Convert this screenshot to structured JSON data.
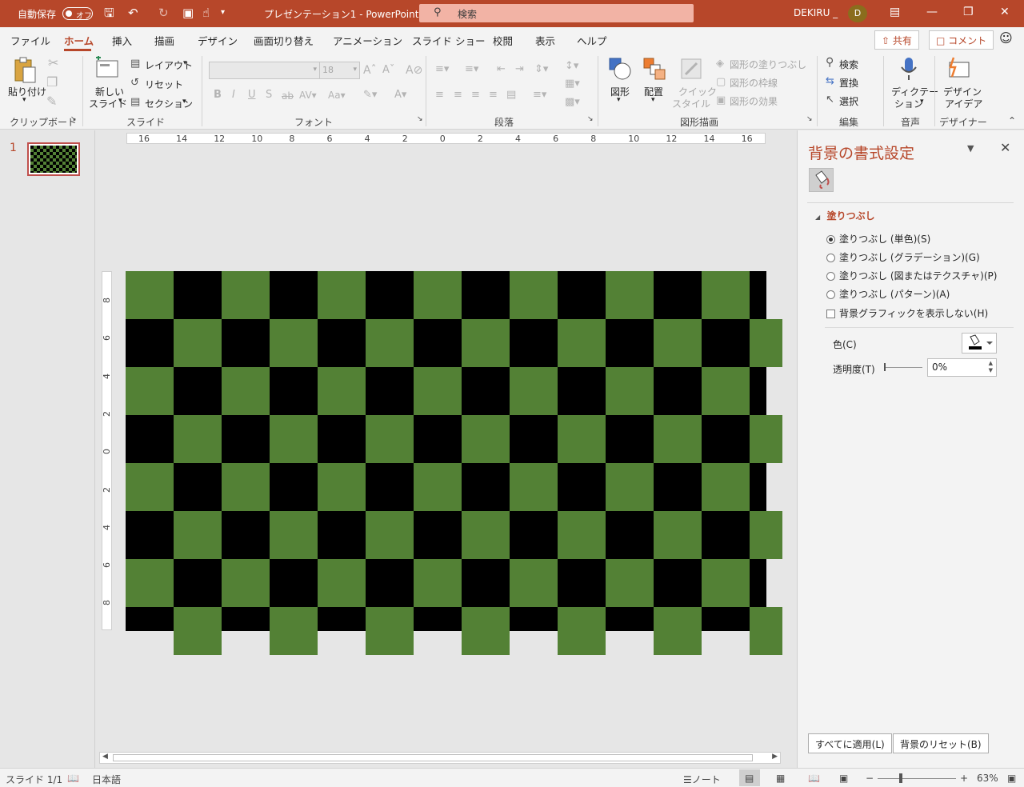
{
  "titlebar": {
    "autosave_label": "自動保存",
    "autosave_state": "オフ",
    "doc_title": "プレゼンテーション1  -  PowerPoint",
    "search_placeholder": "検索",
    "user_name": "DEKIRU _",
    "avatar_initial": "D"
  },
  "tabs": [
    "ファイル",
    "ホーム",
    "挿入",
    "描画",
    "デザイン",
    "画面切り替え",
    "アニメーション",
    "スライド ショー",
    "校閲",
    "表示",
    "ヘルプ"
  ],
  "share_label": "共有",
  "comment_label": "コメント",
  "ribbon": {
    "clipboard": {
      "paste": "貼り付け",
      "group": "クリップボード"
    },
    "slides": {
      "new_slide_1": "新しい",
      "new_slide_2": "スライド",
      "layout": "レイアウト",
      "reset": "リセット",
      "section": "セクション",
      "group": "スライド"
    },
    "font": {
      "font_size": "18",
      "group": "フォント"
    },
    "paragraph": {
      "group": "段落"
    },
    "drawing": {
      "shapes": "図形",
      "arrange": "配置",
      "quick_1": "クイック",
      "quick_2": "スタイル",
      "shape_fill": "図形の塗りつぶし",
      "shape_outline": "図形の枠線",
      "shape_effects": "図形の効果",
      "group": "図形描画"
    },
    "editing": {
      "find": "検索",
      "replace": "置換",
      "select": "選択",
      "group": "編集"
    },
    "voice": {
      "dictate_1": "ディクテー",
      "dictate_2": "ション",
      "group": "音声"
    },
    "designer": {
      "ideas_1": "デザイン",
      "ideas_2": "アイデア",
      "group": "デザイナー"
    }
  },
  "thumbnail_number": "1",
  "ruler": {
    "h_labels": [
      "16",
      "14",
      "12",
      "10",
      "8",
      "6",
      "4",
      "2",
      "0",
      "2",
      "4",
      "6",
      "8",
      "10",
      "12",
      "14",
      "16"
    ],
    "v_labels": [
      "8",
      "6",
      "4",
      "2",
      "0",
      "2",
      "4",
      "6",
      "8"
    ]
  },
  "slide": {
    "colors": {
      "green": "#538135",
      "black": "#000000"
    }
  },
  "format_pane": {
    "title": "背景の書式設定",
    "section": "塗りつぶし",
    "options": [
      {
        "label": "塗りつぶし (単色)(S)",
        "selected": true
      },
      {
        "label": "塗りつぶし (グラデーション)(G)",
        "selected": false
      },
      {
        "label": "塗りつぶし (図またはテクスチャ)(P)",
        "selected": false
      },
      {
        "label": "塗りつぶし (パターン)(A)",
        "selected": false
      }
    ],
    "hide_graphics": "背景グラフィックを表示しない(H)",
    "color_label": "色(C)",
    "transparency_label": "透明度(T)",
    "transparency_value": "0%",
    "apply_all": "すべてに適用(L)",
    "reset_bg": "背景のリセット(B)"
  },
  "status": {
    "slide_info": "スライド 1/1",
    "language": "日本語",
    "notes": "ノート",
    "zoom": "63%"
  }
}
